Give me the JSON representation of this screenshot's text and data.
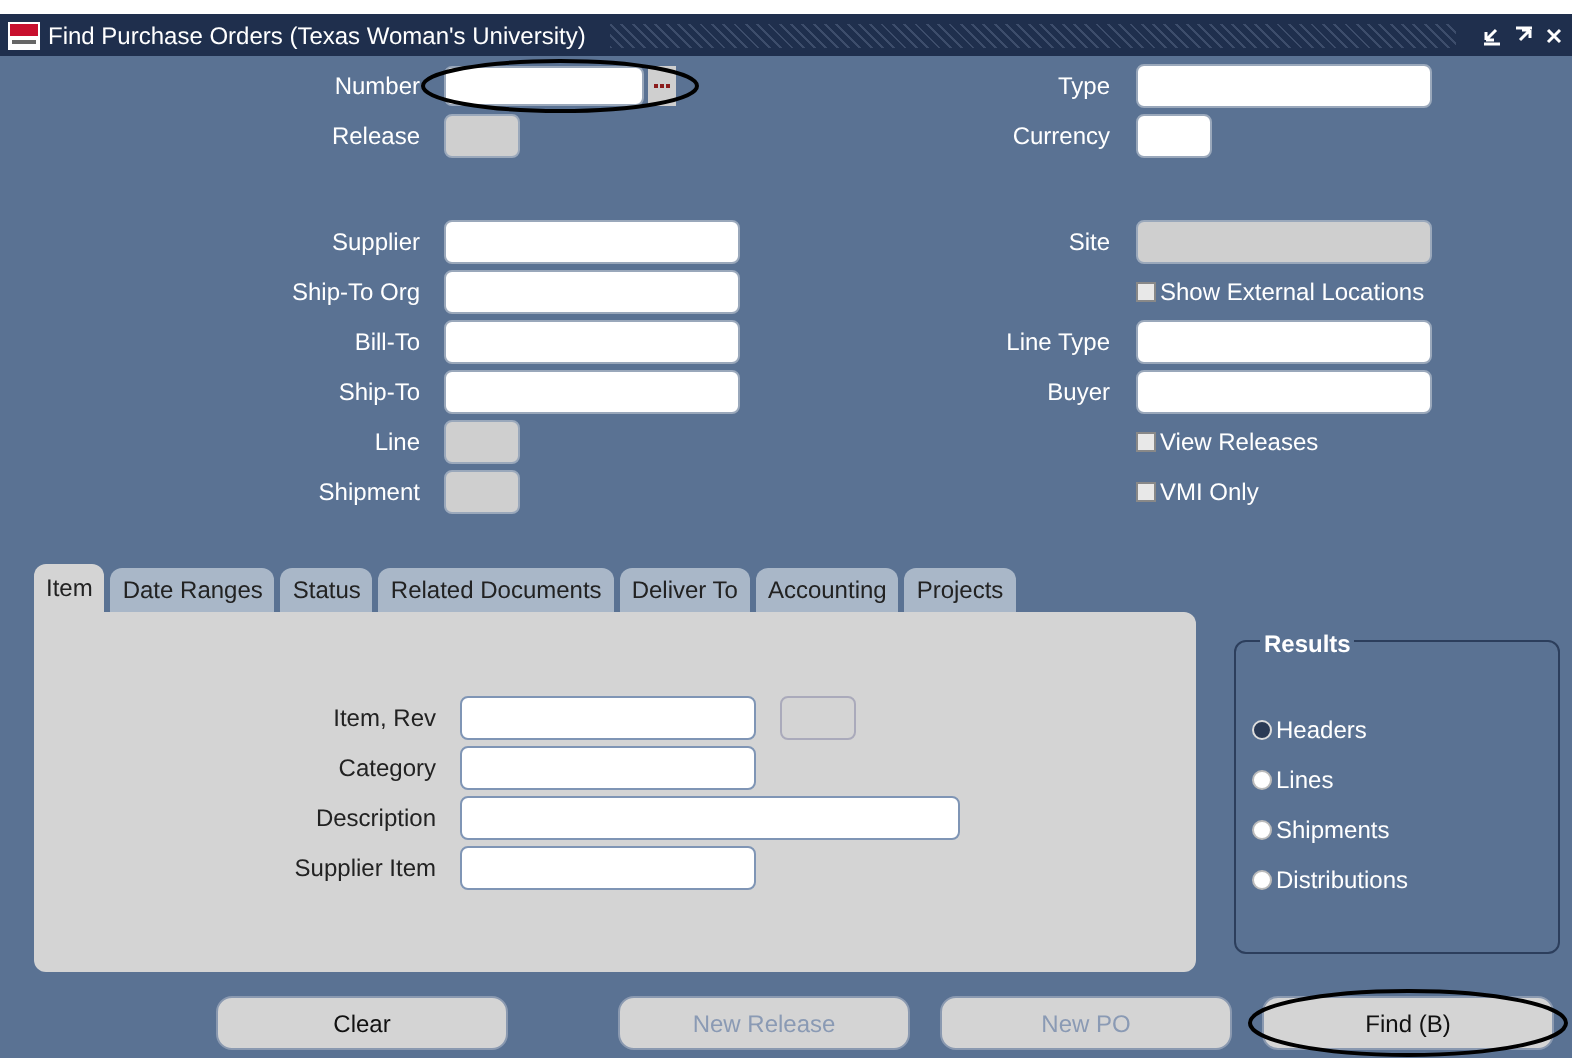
{
  "window": {
    "title": "Find Purchase Orders (Texas Woman's University)"
  },
  "header_rows": [
    {
      "left": {
        "label": "Number",
        "kind": "lov",
        "disabled": false,
        "circled": true
      },
      "right": {
        "label": "Type",
        "kind": "text",
        "disabled": false,
        "circled": false
      }
    },
    {
      "left": {
        "label": "Release",
        "kind": "short",
        "disabled": true,
        "circled": false
      },
      "right": {
        "label": "Currency",
        "kind": "short",
        "disabled": false,
        "circled": false
      }
    }
  ],
  "detail_rows": [
    {
      "left": {
        "label": "Supplier",
        "kind": "text",
        "disabled": false
      },
      "right": {
        "label": "Site",
        "kind": "text",
        "disabled": true
      }
    },
    {
      "left": {
        "label": "Ship-To Org",
        "kind": "text",
        "disabled": false
      },
      "right": {
        "label": "Show External Locations",
        "kind": "checkbox",
        "checked": false
      }
    },
    {
      "left": {
        "label": "Bill-To",
        "kind": "text",
        "disabled": false
      },
      "right": {
        "label": "Line Type",
        "kind": "text",
        "disabled": false
      }
    },
    {
      "left": {
        "label": "Ship-To",
        "kind": "text",
        "disabled": false
      },
      "right": {
        "label": "Buyer",
        "kind": "text",
        "disabled": false
      }
    },
    {
      "left": {
        "label": "Line",
        "kind": "short",
        "disabled": true
      },
      "right": {
        "label": "View Releases",
        "kind": "checkbox",
        "checked": false
      }
    },
    {
      "left": {
        "label": "Shipment",
        "kind": "short",
        "disabled": true
      },
      "right": {
        "label": "VMI Only",
        "kind": "checkbox",
        "checked": false
      }
    }
  ],
  "tabs": [
    {
      "label": "Item",
      "selected": true
    },
    {
      "label": "Date Ranges",
      "selected": false
    },
    {
      "label": "Status",
      "selected": false
    },
    {
      "label": "Related Documents",
      "selected": false
    },
    {
      "label": "Deliver To",
      "selected": false
    },
    {
      "label": "Accounting",
      "selected": false
    },
    {
      "label": "Projects",
      "selected": false
    }
  ],
  "item_fields": [
    {
      "label": "Item, Rev",
      "kind": "item_rev"
    },
    {
      "label": "Category",
      "kind": "text"
    },
    {
      "label": "Description",
      "kind": "wide"
    },
    {
      "label": "Supplier Item",
      "kind": "text"
    }
  ],
  "results": {
    "title": "Results",
    "options": [
      {
        "label": "Headers",
        "selected": true
      },
      {
        "label": "Lines",
        "selected": false
      },
      {
        "label": "Shipments",
        "selected": false
      },
      {
        "label": "Distributions",
        "selected": false
      }
    ]
  },
  "buttons": [
    {
      "label": "Clear",
      "disabled": false,
      "circled": false
    },
    {
      "label": "New Release",
      "disabled": true,
      "circled": false
    },
    {
      "label": "New PO",
      "disabled": true,
      "circled": false
    },
    {
      "label": "Find (B)",
      "disabled": false,
      "circled": true
    }
  ]
}
